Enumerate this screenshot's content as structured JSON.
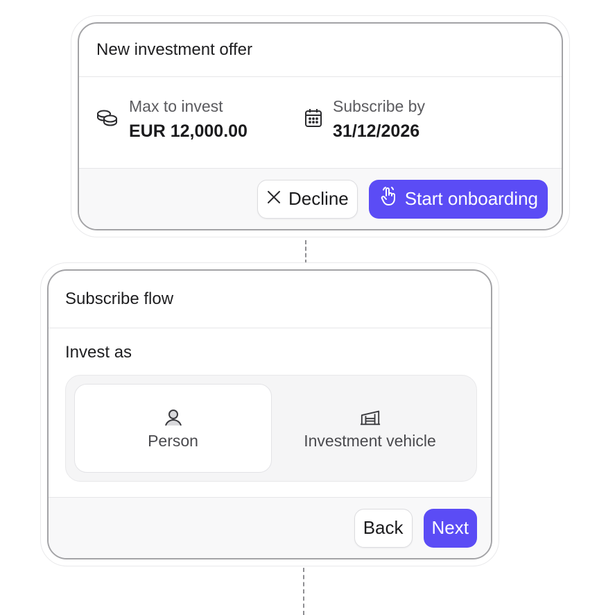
{
  "offer_card": {
    "title": "New investment offer",
    "max_invest": {
      "icon": "coins-icon",
      "label": "Max to invest",
      "value": "EUR 12,000.00"
    },
    "subscribe_by": {
      "icon": "calendar-icon",
      "label": "Subscribe by",
      "value": "31/12/2026"
    },
    "decline_button": {
      "icon": "close-icon",
      "label": "Decline"
    },
    "start_button": {
      "icon": "pointer-hand-icon",
      "label": "Start onboarding"
    }
  },
  "subscribe_card": {
    "title": "Subscribe flow",
    "invest_as_label": "Invest as",
    "options": [
      {
        "icon": "person-icon",
        "label": "Person",
        "selected": true
      },
      {
        "icon": "building-icon",
        "label": "Investment vehicle",
        "selected": false
      }
    ],
    "back_button": {
      "label": "Back"
    },
    "next_button": {
      "label": "Next"
    }
  },
  "colors": {
    "accent": "#5b4cf5",
    "card_border": "#a3a3a6",
    "footer_bg": "#f8f8f9"
  }
}
